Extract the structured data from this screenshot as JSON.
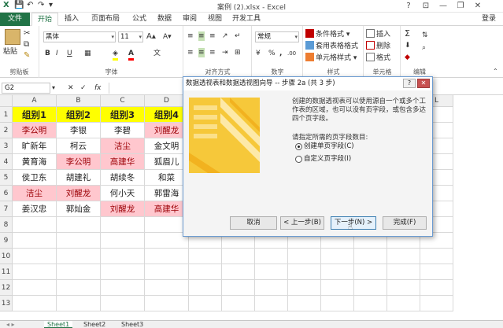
{
  "window": {
    "title": "案例 (2).xlsx - Excel",
    "help_glyph": "?",
    "minimize_glyph": "—",
    "restore_glyph": "❐",
    "close_glyph": "✕",
    "ribbon_display_glyph": "⊡"
  },
  "quick_access": {
    "save_glyph": "💾",
    "undo_glyph": "↶",
    "redo_glyph": "↷",
    "more_glyph": "▾"
  },
  "tabs": [
    "文件",
    "开始",
    "插入",
    "页面布局",
    "公式",
    "数据",
    "审阅",
    "视图",
    "开发工具"
  ],
  "active_tab": "开始",
  "login": "登录",
  "ribbon": {
    "clipboard": {
      "paste": "粘贴",
      "label": "剪贴板"
    },
    "font": {
      "name": "黑体",
      "size": "11",
      "label": "字体"
    },
    "alignment": {
      "label": "对齐方式"
    },
    "number": {
      "format": "常规",
      "label": "数字",
      "percent": "%",
      "comma": ","
    },
    "styles": {
      "conditional": "条件格式",
      "table": "套用表格格式",
      "cell": "单元格样式",
      "label": "样式"
    },
    "cells": {
      "insert": "插入",
      "delete": "删除",
      "format": "格式",
      "label": "单元格"
    },
    "editing": {
      "sum": "Σ",
      "label": "编辑"
    }
  },
  "formula_bar": {
    "name_box": "G2",
    "fx": "fx",
    "value": ""
  },
  "columns": [
    "A",
    "B",
    "C",
    "D",
    "E",
    "F",
    "G",
    "H",
    "I",
    "J",
    "K",
    "L"
  ],
  "rows": [
    "1",
    "2",
    "3",
    "4",
    "5",
    "6",
    "7",
    "8",
    "9",
    "10",
    "11",
    "12",
    "13"
  ],
  "table": {
    "headers": [
      "组别1",
      "组别2",
      "组别3",
      "组别4"
    ],
    "cells": [
      [
        "李公明",
        "李银",
        "李碧",
        "刘醒龙"
      ],
      [
        "旷新年",
        "柯云",
        "洁尘",
        "金文明"
      ],
      [
        "黄育海",
        "李公明",
        "高建华",
        "狐眉儿"
      ],
      [
        "侯卫东",
        "胡建礼",
        "胡续冬",
        "和菜"
      ],
      [
        "洁尘",
        "刘醒龙",
        "何小天",
        "郭雷海"
      ],
      [
        "姜汉忠",
        "郭灿金",
        "刘醒龙",
        "高建华"
      ]
    ],
    "highlight": [
      [
        true,
        false,
        false,
        true
      ],
      [
        false,
        false,
        true,
        false
      ],
      [
        false,
        true,
        true,
        false
      ],
      [
        false,
        false,
        false,
        false
      ],
      [
        true,
        true,
        false,
        false
      ],
      [
        false,
        false,
        true,
        true
      ]
    ],
    "highlight_fill": "#ffc7ce",
    "highlight_text": "#9c0006",
    "header_fill": "#ffff00"
  },
  "sheets": [
    "Sheet1",
    "Sheet2",
    "Sheet3"
  ],
  "active_sheet": "Sheet1",
  "dialog": {
    "title": "数据透视表和数据透视图向导 -- 步骤 2a (共 3 步)",
    "help": "?",
    "close": "✕",
    "description": "创建的数据透视表可以使用源自一个或多个工作表的区域，也可以没有页字段，或包含多达四个页字段。",
    "question": "请指定所需的页字段数目:",
    "options": [
      "创建单页字段(C)",
      "自定义页字段(I)"
    ],
    "selected_option": 0,
    "buttons": {
      "cancel": "取消",
      "back": "< 上一步(B)",
      "next": "下一步(N) >",
      "finish": "完成(F)"
    },
    "illustration_color": "#f6c83a"
  },
  "accent_color": "#217346"
}
